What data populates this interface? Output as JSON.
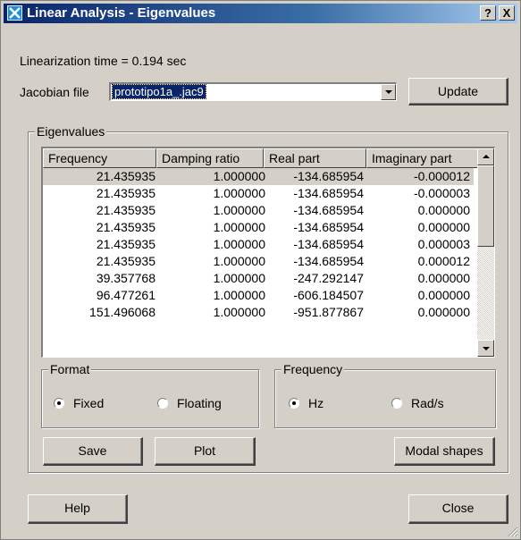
{
  "window": {
    "title": "Linear Analysis - Eigenvalues",
    "help_glyph": "?",
    "close_glyph": "X"
  },
  "linearization_text": "Linearization time = 0.194 sec",
  "jacobian": {
    "label": "Jacobian file",
    "selected_value": "prototipo1a_.jac9",
    "update_label": "Update"
  },
  "eigenvalues": {
    "group_title": "Eigenvalues",
    "columns": [
      "Frequency",
      "Damping ratio",
      "Real part",
      "Imaginary part"
    ],
    "rows": [
      [
        "21.435935",
        "1.000000",
        "-134.685954",
        "-0.000012"
      ],
      [
        "21.435935",
        "1.000000",
        "-134.685954",
        "-0.000003"
      ],
      [
        "21.435935",
        "1.000000",
        "-134.685954",
        "0.000000"
      ],
      [
        "21.435935",
        "1.000000",
        "-134.685954",
        "0.000000"
      ],
      [
        "21.435935",
        "1.000000",
        "-134.685954",
        "0.000003"
      ],
      [
        "21.435935",
        "1.000000",
        "-134.685954",
        "0.000012"
      ],
      [
        "39.357768",
        "1.000000",
        "-247.292147",
        "0.000000"
      ],
      [
        "96.477261",
        "1.000000",
        "-606.184507",
        "0.000000"
      ],
      [
        "151.496068",
        "1.000000",
        "-951.877867",
        "0.000000"
      ]
    ],
    "selected_row": 0
  },
  "format": {
    "group_title": "Format",
    "options": [
      "Fixed",
      "Floating"
    ],
    "selected": "Fixed"
  },
  "frequency": {
    "group_title": "Frequency",
    "options": [
      "Hz",
      "Rad/s"
    ],
    "selected": "Hz"
  },
  "buttons": {
    "save": "Save",
    "plot": "Plot",
    "modal_shapes": "Modal shapes",
    "help": "Help",
    "close": "Close"
  },
  "colors": {
    "title_gradient_start": "#0a246a",
    "title_gradient_end": "#a6caf0",
    "face": "#d4d0c8",
    "selection": "#0a246a"
  }
}
